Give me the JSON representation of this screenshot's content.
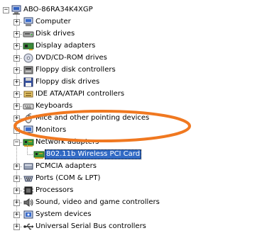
{
  "root": {
    "label": "ABO-86RA34K4XGP",
    "icon": "computer-root-icon"
  },
  "items": [
    {
      "label": "Computer",
      "icon": "computer-icon",
      "expander": "+"
    },
    {
      "label": "Disk drives",
      "icon": "disk-drive-icon",
      "expander": "+"
    },
    {
      "label": "Display adapters",
      "icon": "display-adapter-icon",
      "expander": "+"
    },
    {
      "label": "DVD/CD-ROM drives",
      "icon": "cd-rom-icon",
      "expander": "+"
    },
    {
      "label": "Floppy disk controllers",
      "icon": "floppy-controller-icon",
      "expander": "+"
    },
    {
      "label": "Floppy disk drives",
      "icon": "floppy-disk-icon",
      "expander": "+"
    },
    {
      "label": "IDE ATA/ATAPI controllers",
      "icon": "ide-controller-icon",
      "expander": "+"
    },
    {
      "label": "Keyboards",
      "icon": "keyboard-icon",
      "expander": "+"
    },
    {
      "label": "Mice and other pointing devices",
      "icon": "mouse-icon",
      "expander": "+"
    },
    {
      "label": "Monitors",
      "icon": "monitor-icon",
      "expander": "+"
    },
    {
      "label": "Network adapters",
      "icon": "network-adapter-icon",
      "expander": "-"
    },
    {
      "label": "802.11b Wireless PCI Card",
      "icon": "network-card-icon",
      "child": true,
      "selected": true
    },
    {
      "label": "PCMCIA adapters",
      "icon": "pcmcia-icon",
      "expander": "+"
    },
    {
      "label": "Ports (COM & LPT)",
      "icon": "port-icon",
      "expander": "+"
    },
    {
      "label": "Processors",
      "icon": "processor-icon",
      "expander": "+"
    },
    {
      "label": "Sound, video and game controllers",
      "icon": "sound-icon",
      "expander": "+"
    },
    {
      "label": "System devices",
      "icon": "system-device-icon",
      "expander": "+"
    },
    {
      "label": "Universal Serial Bus controllers",
      "icon": "usb-icon",
      "expander": "+"
    }
  ],
  "colors": {
    "selection": "#316ac5",
    "annotation": "#f07820"
  }
}
